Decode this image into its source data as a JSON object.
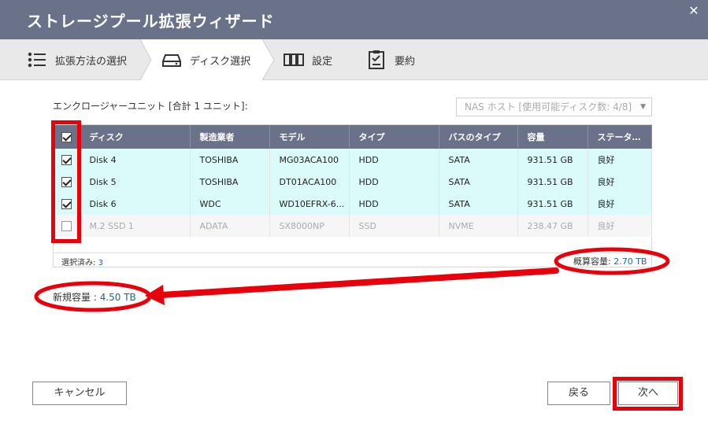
{
  "window": {
    "title": "ストレージプール拡張ウィザード",
    "close_glyph": "✕"
  },
  "steps": [
    {
      "label": "拡張方法の選択",
      "icon": "list-icon"
    },
    {
      "label": "ディスク選択",
      "icon": "drive-icon"
    },
    {
      "label": "設定",
      "icon": "settings-icon"
    },
    {
      "label": "要約",
      "icon": "clipboard-icon"
    }
  ],
  "enclosure": {
    "label": "エンクロージャーユニット [合計 1 ユニット]:",
    "select_value": "NAS ホスト [使用可能ディスク数: 4/8]"
  },
  "table": {
    "columns": [
      "ディスク",
      "製造業者",
      "モデル",
      "タイプ",
      "バスのタイプ",
      "容量",
      "ステータ…"
    ],
    "rows": [
      {
        "checked": true,
        "cells": [
          "Disk 4",
          "TOSHIBA",
          "MG03ACA100",
          "HDD",
          "SATA",
          "931.51 GB",
          "良好"
        ]
      },
      {
        "checked": true,
        "cells": [
          "Disk 5",
          "TOSHIBA",
          "DT01ACA100",
          "HDD",
          "SATA",
          "931.51 GB",
          "良好"
        ]
      },
      {
        "checked": true,
        "cells": [
          "Disk 6",
          "WDC",
          "WD10EFRX-6...",
          "HDD",
          "SATA",
          "931.51 GB",
          "良好"
        ]
      },
      {
        "checked": false,
        "disabled": true,
        "cells": [
          "M.2 SSD 1",
          "ADATA",
          "SX8000NP",
          "SSD",
          "NVME",
          "238.47 GB",
          "良好"
        ]
      }
    ],
    "footer": {
      "selected_label": "選択済み: ",
      "selected_count": "3"
    }
  },
  "capacity": {
    "estimated_label": "概算容量: ",
    "estimated_value": "2.70 TB",
    "new_label": "新規容量 : ",
    "new_value": "4.50 TB"
  },
  "buttons": {
    "cancel": "キャンセル",
    "back": "戻る",
    "next": "次へ"
  },
  "colors": {
    "header": "#6a7289",
    "selected_row": "#dbfbfb",
    "link_blue": "#1f63a8",
    "annotation_red": "#e8000a"
  }
}
